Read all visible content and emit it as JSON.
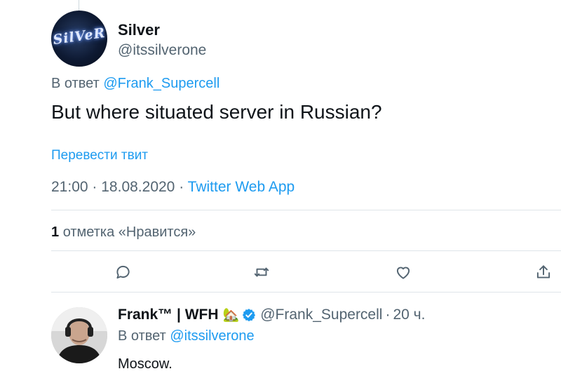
{
  "main_tweet": {
    "author_name": "Silver",
    "author_handle": "@itssilverone",
    "avatar_text": "SilVeR",
    "reply_prefix": "В ответ",
    "reply_to": "@Frank_Supercell",
    "text": "But where situated server in Russian?",
    "translate_label": "Перевести твит",
    "time": "21:00",
    "date": "18.08.2020",
    "separator": "·",
    "source": "Twitter Web App",
    "like_count": "1",
    "like_label": "отметка «Нравится»"
  },
  "actions": {
    "icons": [
      "reply-icon",
      "retweet-icon",
      "like-icon",
      "share-icon"
    ]
  },
  "reply_tweet": {
    "author_name": "Frank™ | WFH",
    "emoji": "🏡",
    "author_handle": "@Frank_Supercell",
    "separator": "·",
    "time_ago": "20 ч.",
    "reply_prefix": "В ответ",
    "reply_to": "@itssilverone",
    "text": "Moscow."
  },
  "colors": {
    "accent": "#1d9bf0",
    "secondary_text": "#536471",
    "primary_text": "#0f1419",
    "divider": "#dfe5e9"
  }
}
